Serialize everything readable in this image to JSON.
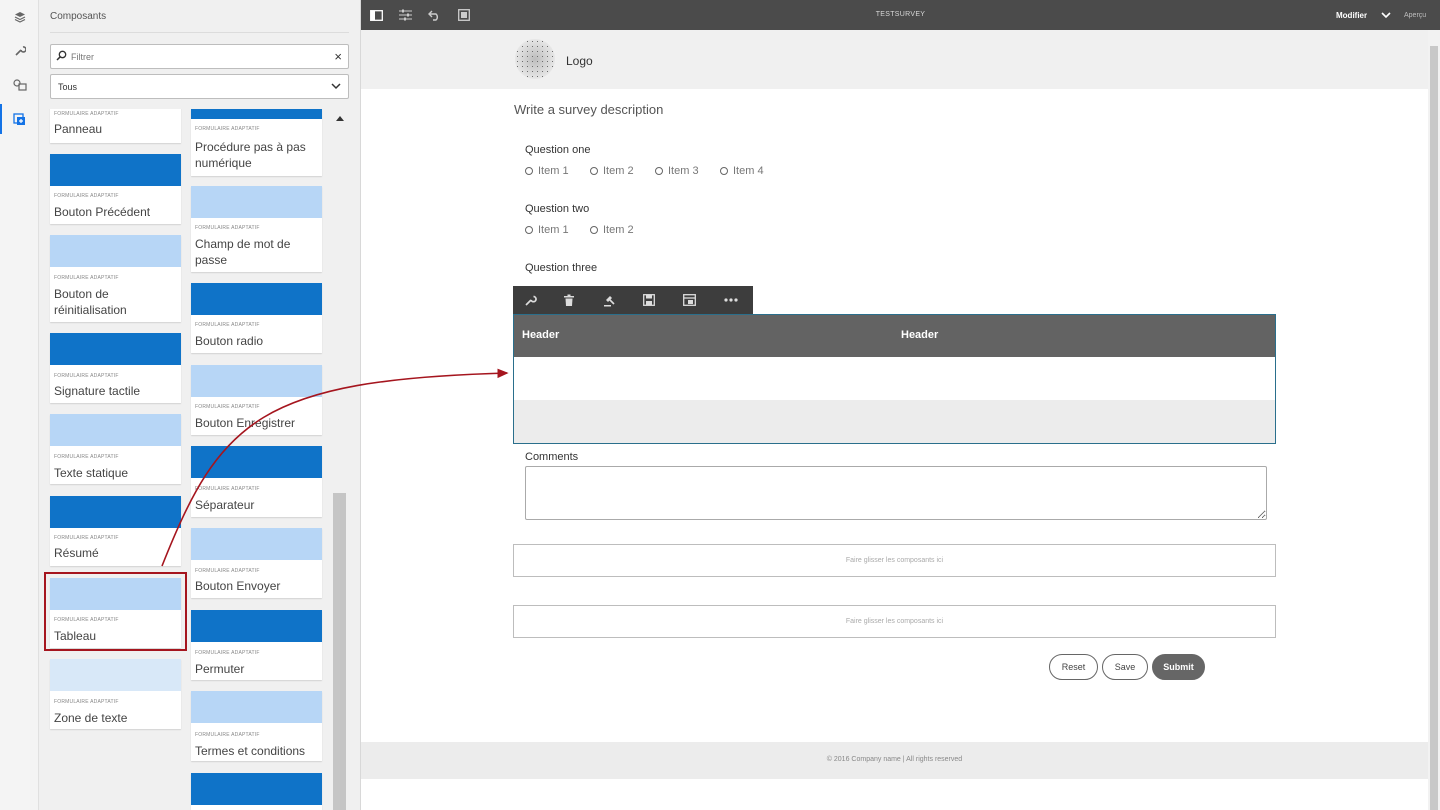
{
  "rail": {
    "icons": [
      "layers-icon",
      "wrench-icon",
      "assets-icon",
      "components-icon"
    ]
  },
  "panel": {
    "title": "Composants",
    "filter_placeholder": "Filtrer",
    "filter_clear": "×",
    "category_select": "Tous",
    "category_label": "FORMULAIRE ADAPTATIF",
    "left_column": [
      {
        "name": "Panneau",
        "color": "#ffffff"
      },
      {
        "name": "Bouton Précédent",
        "color": "#0f73c8"
      },
      {
        "name": "Bouton de réinitialisation",
        "color": "#b7d6f6"
      },
      {
        "name": "Signature tactile",
        "color": "#0f73c8"
      },
      {
        "name": "Texte statique",
        "color": "#b7d6f6"
      },
      {
        "name": "Résumé",
        "color": "#0f73c8"
      },
      {
        "name": "Tableau",
        "color": "#b7d6f6"
      },
      {
        "name": "Zone de texte",
        "color": "#d8e8f8"
      }
    ],
    "right_column": [
      {
        "name": "Procédure pas à pas numérique",
        "color": "#0f73c8"
      },
      {
        "name": "Champ de mot de passe",
        "color": "#b7d6f6"
      },
      {
        "name": "Bouton radio",
        "color": "#0f73c8"
      },
      {
        "name": "Bouton Enregistrer",
        "color": "#b7d6f6"
      },
      {
        "name": "Séparateur",
        "color": "#0f73c8"
      },
      {
        "name": "Bouton Envoyer",
        "color": "#b7d6f6"
      },
      {
        "name": "Permuter",
        "color": "#0f73c8"
      },
      {
        "name": "Termes et conditions",
        "color": "#b7d6f6"
      },
      {
        "name": "",
        "color": "#0f73c8"
      }
    ]
  },
  "topbar": {
    "title": "TESTSURVEY",
    "mode": "Modifier",
    "preview": "Aperçu"
  },
  "form": {
    "logo": "Logo",
    "description": "Write a survey description",
    "questions": [
      {
        "label": "Question one",
        "options": [
          "Item 1",
          "Item 2",
          "Item 3",
          "Item 4"
        ]
      },
      {
        "label": "Question two",
        "options": [
          "Item 1",
          "Item 2"
        ]
      },
      {
        "label": "Question three",
        "options": []
      }
    ],
    "table": {
      "headers": [
        "Header",
        "Header"
      ],
      "toolbar_icons": [
        "wrench-icon",
        "trash-icon",
        "gavel-icon",
        "save-icon",
        "layout-icon",
        "more-icon"
      ]
    },
    "comments_label": "Comments",
    "dropzones": [
      "Faire glisser les composants ici",
      "Faire glisser les composants ici"
    ],
    "buttons": {
      "reset": "Reset",
      "save": "Save",
      "submit": "Submit"
    },
    "footer": "© 2016 Company name | All rights reserved"
  },
  "colors": {
    "accent": "#1473e6",
    "highlight_box": "#a5151e",
    "topbar": "#4b4b4b"
  }
}
